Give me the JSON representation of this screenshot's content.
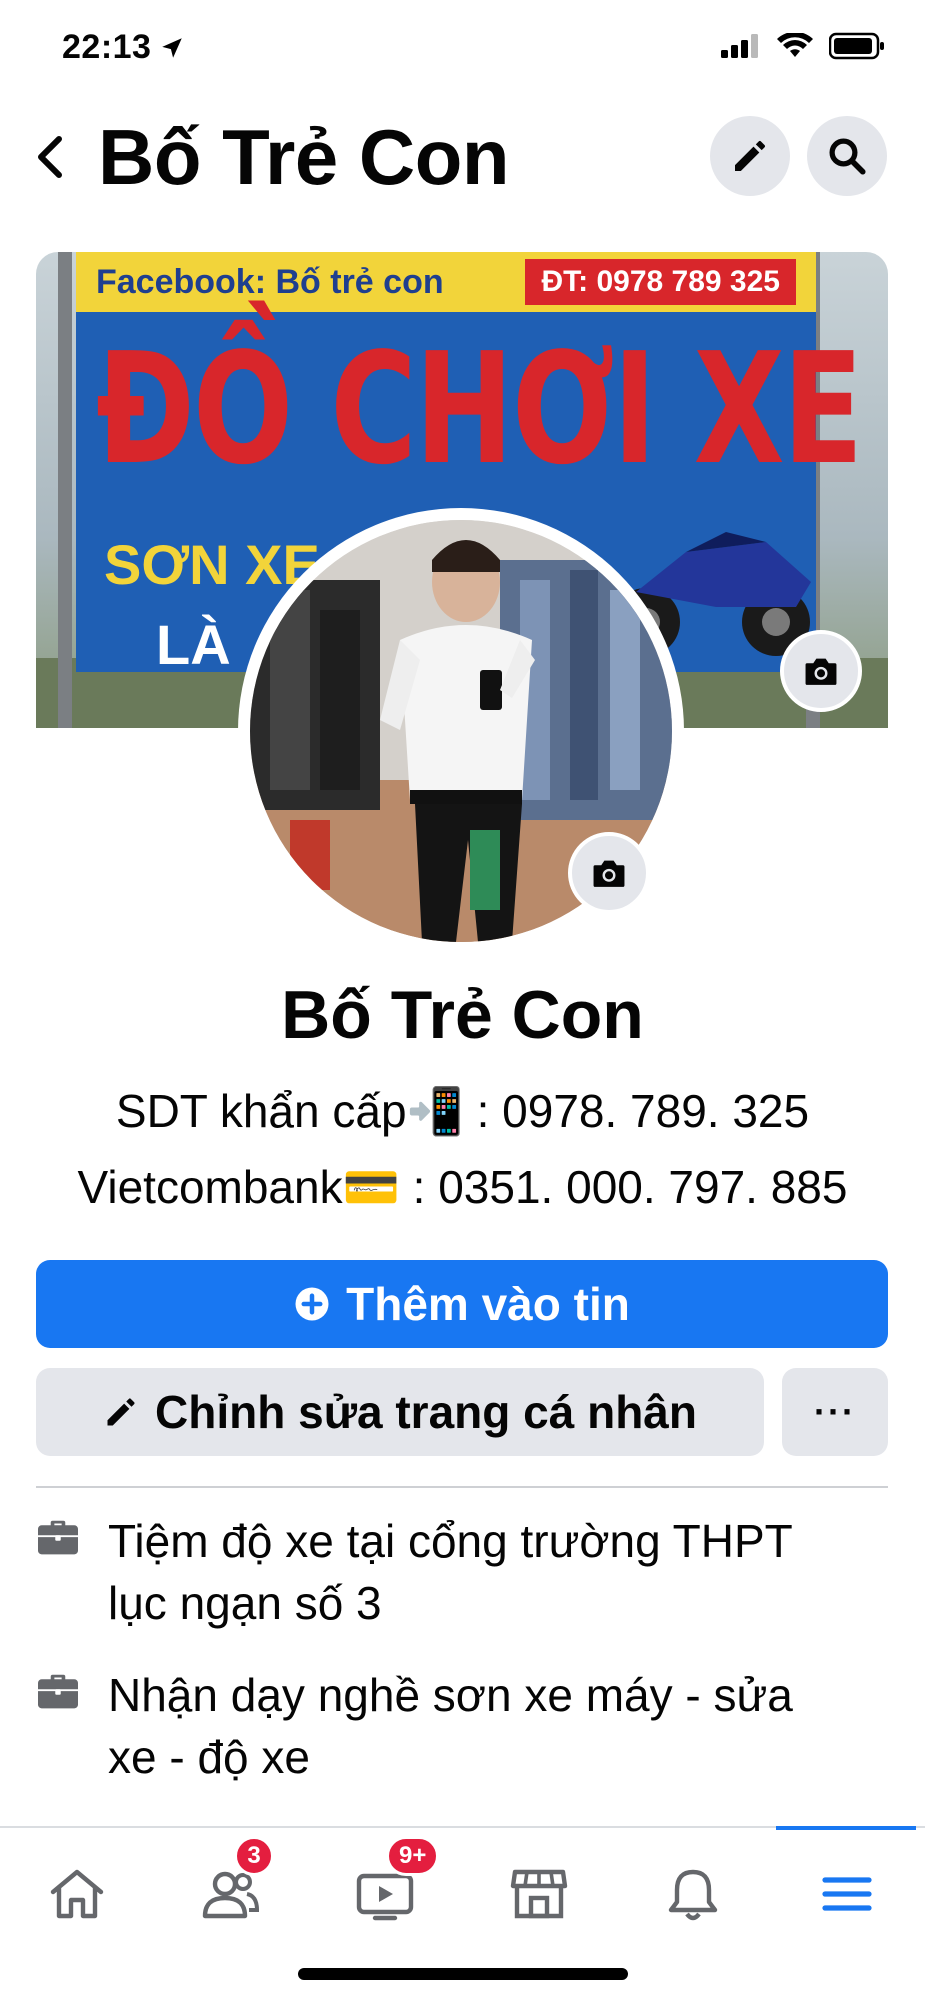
{
  "status_bar": {
    "time": "22:13",
    "icons": [
      "location-arrow-icon",
      "signal-icon",
      "wifi-icon",
      "battery-icon"
    ]
  },
  "header": {
    "title": "Bố Trẻ Con",
    "icons": [
      "back-chevron-icon",
      "pencil-icon",
      "search-icon"
    ]
  },
  "cover": {
    "sign_facebook": "Facebook: Bố trẻ con",
    "sign_phone": "ĐT: 0978 789 325",
    "sign_main": "ĐỒ CHƠI XE MÁY",
    "sign_sub": "SƠN XE",
    "sign_sub2": "LÀ",
    "icon": "camera-icon"
  },
  "profile": {
    "name": "Bố Trẻ Con",
    "bio_line_1": "SDT khẩn cấp📲 : 0978. 789. 325",
    "bio_line_2": "Vietcombank💳 : 0351. 000. 797. 885"
  },
  "actions": {
    "add_story_label": "Thêm vào tin",
    "edit_profile_label": "Chỉnh sửa trang cá nhân",
    "more_label": "···"
  },
  "intro": [
    {
      "icon": "briefcase-icon",
      "text": "Tiệm độ xe tại cổng trường THPT lục ngạn số 3"
    },
    {
      "icon": "briefcase-icon",
      "text": "Nhận dạy nghề sơn xe máy - sửa xe - độ xe"
    }
  ],
  "bottom_nav": {
    "items": [
      {
        "icon": "home-icon"
      },
      {
        "icon": "friends-icon",
        "badge": "3"
      },
      {
        "icon": "watch-video-icon",
        "badge": "9+"
      },
      {
        "icon": "marketplace-icon"
      },
      {
        "icon": "notifications-bell-icon"
      },
      {
        "icon": "menu-icon",
        "active": true
      }
    ]
  },
  "colors": {
    "accent": "#1877f2",
    "button_grey": "#e4e6eb",
    "badge_red": "#e41e3f"
  }
}
